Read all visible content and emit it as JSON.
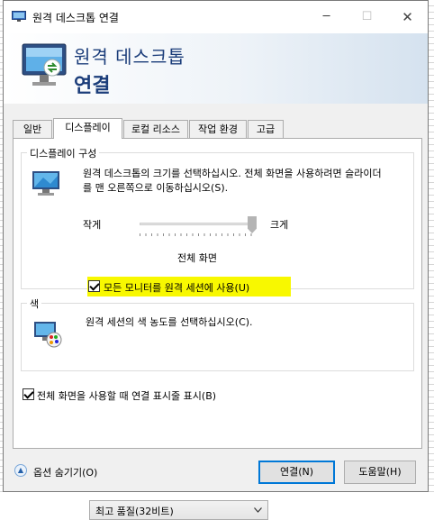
{
  "window": {
    "title": "원격 데스크톱 연결",
    "controls": {
      "minimize": "─",
      "maximize": "☐",
      "close": "✕"
    }
  },
  "banner": {
    "title": "원격 데스크톱",
    "subtitle": "연결"
  },
  "tabs": [
    {
      "label": "일반",
      "active": false
    },
    {
      "label": "디스플레이",
      "active": true
    },
    {
      "label": "로컬 리소스",
      "active": false
    },
    {
      "label": "작업 환경",
      "active": false
    },
    {
      "label": "고급",
      "active": false
    }
  ],
  "display_config": {
    "group_label": "디스플레이 구성",
    "description": "원격 데스크톱의 크기를 선택하십시오. 전체 화면을 사용하려면 슬라이더를 맨 오른쪽으로 이동하십시오(S).",
    "slider_min_label": "작게",
    "slider_max_label": "크게",
    "slider_value_fraction": 1.0,
    "slider_value_text": "전체 화면",
    "all_monitors": {
      "label": "모든 모니터를 원격 세션에 사용(U)",
      "checked": true,
      "highlight_color": "#f8f800"
    }
  },
  "colors": {
    "group_label": "색",
    "description": "원격 세션의 색 농도를 선택하십시오(C).",
    "selected": "최고 품질(32비트)"
  },
  "connection_bar": {
    "label": "전체 화면을 사용할 때 연결 표시줄 표시(B)",
    "checked": true
  },
  "footer": {
    "options_label": "옵션 숨기기(O)",
    "connect_label": "연결(N)",
    "help_label": "도움말(H)"
  },
  "accent": "#1b3d7a",
  "focus_color": "#0078d7"
}
